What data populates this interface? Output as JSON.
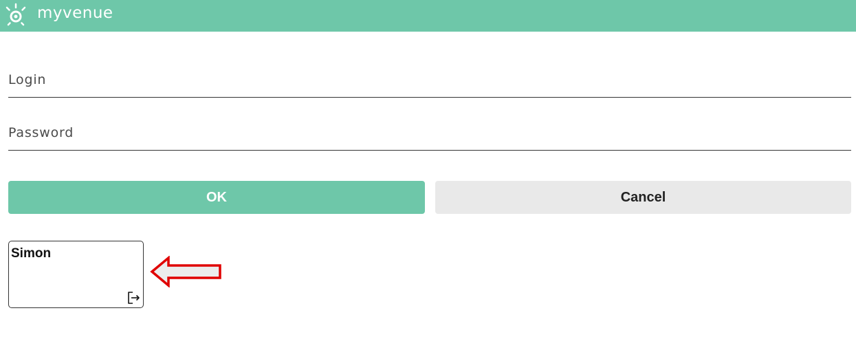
{
  "header": {
    "app_name": "myvenue",
    "logo_icon": "sun-logo-icon",
    "background_color": "#6ec7a9"
  },
  "form": {
    "login_label": "Login",
    "login_value": "",
    "password_label": "Password",
    "password_value": ""
  },
  "buttons": {
    "ok_label": "OK",
    "cancel_label": "Cancel",
    "ok_color": "#6ec7a9",
    "cancel_color": "#e9e9e9"
  },
  "user_card": {
    "name": "Simon",
    "action_icon": "logout-icon"
  },
  "annotation": {
    "icon": "red-arrow-left-icon",
    "color": "#e00000"
  }
}
